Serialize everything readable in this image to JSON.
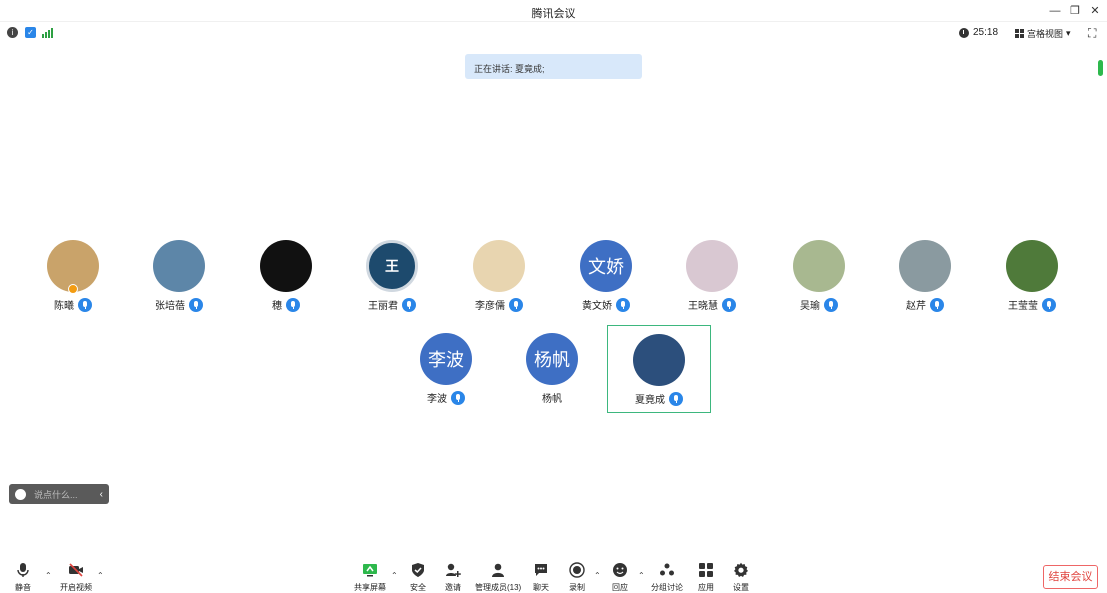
{
  "window": {
    "title": "腾讯会议"
  },
  "status": {
    "timer": "25:18",
    "view_mode": "宫格视图"
  },
  "speaking": {
    "text": "正在讲话: 夏竟成;"
  },
  "participants": [
    {
      "name": "陈曦",
      "avatar_type": "photo",
      "avatar_color": "#c9a36a",
      "mic": true,
      "host": true
    },
    {
      "name": "张培蓓",
      "avatar_type": "photo",
      "avatar_color": "#5d86a8",
      "mic": true
    },
    {
      "name": "穗",
      "avatar_type": "photo",
      "avatar_color": "#111111",
      "mic": true
    },
    {
      "name": "王丽君",
      "avatar_type": "photo",
      "avatar_text": "王",
      "avatar_color": "#1d4a6d",
      "mic": true
    },
    {
      "name": "李彦儒",
      "avatar_type": "photo",
      "avatar_color": "#e8d5b0",
      "mic": true
    },
    {
      "name": "黄文娇",
      "avatar_type": "text",
      "avatar_text": "文娇",
      "mic": true
    },
    {
      "name": "王晓慧",
      "avatar_type": "photo",
      "avatar_color": "#d9c8d2",
      "mic": true
    },
    {
      "name": "吴瑜",
      "avatar_type": "photo",
      "avatar_color": "#a8b890",
      "mic": true
    },
    {
      "name": "赵芹",
      "avatar_type": "photo",
      "avatar_color": "#8a9aa0",
      "mic": true
    },
    {
      "name": "王莹莹",
      "avatar_type": "photo",
      "avatar_color": "#4f7a3a",
      "mic": true
    },
    {
      "name": "李波",
      "avatar_type": "text",
      "avatar_text": "李波",
      "mic": true
    },
    {
      "name": "杨帆",
      "avatar_type": "text",
      "avatar_text": "杨帆",
      "mic": false
    },
    {
      "name": "夏竟成",
      "avatar_type": "photo",
      "avatar_color": "#2c4f7c",
      "mic": true,
      "active": true
    }
  ],
  "chat": {
    "placeholder": "说点什么..."
  },
  "toolbar": {
    "mute": "静音",
    "video": "开启视频",
    "share": "共享屏幕",
    "security": "安全",
    "invite": "邀请",
    "members": "管理成员(13)",
    "chat": "聊天",
    "record": "录制",
    "react": "回应",
    "breakout": "分组讨论",
    "apps": "应用",
    "settings": "设置",
    "end": "结束会议"
  },
  "colors": {
    "accent": "#2a86e8",
    "avatar_text_bg": "#3e6fc4",
    "active_border": "#3db77e",
    "end_red": "#e0443e",
    "speaking_bg": "#d8e8fa"
  }
}
